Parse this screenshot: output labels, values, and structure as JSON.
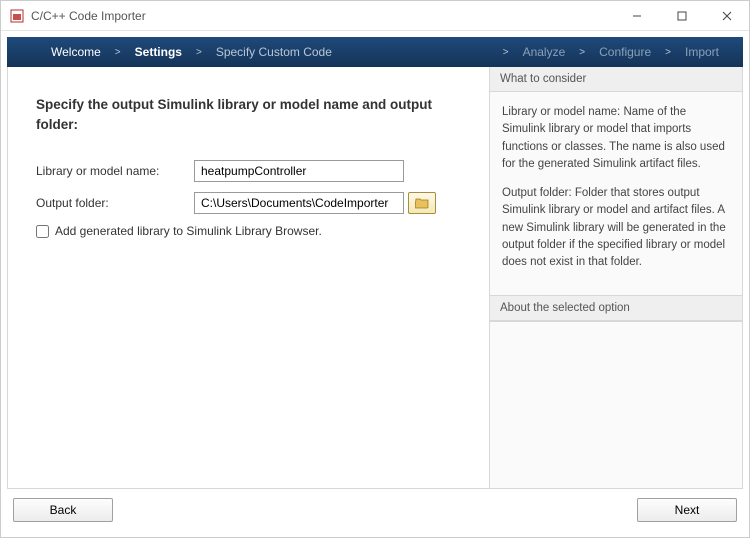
{
  "window": {
    "title": "C/C++ Code Importer"
  },
  "steps": {
    "welcome": "Welcome",
    "settings": "Settings",
    "specify": "Specify Custom Code",
    "analyze": "Analyze",
    "configure": "Configure",
    "import": "Import"
  },
  "page": {
    "heading": "Specify the output Simulink library or model name and output folder:",
    "libLabel": "Library or model name:",
    "libValue": "heatpumpController",
    "folderLabel": "Output folder:",
    "folderValue": "C:\\Users\\Documents\\CodeImporter",
    "addLibLabel": "Add generated library to Simulink Library Browser."
  },
  "help": {
    "considerHead": "What to consider",
    "considerP1": "Library or model name: Name of the Simulink library or model that imports functions or classes. The name is also used for the generated Simulink artifact files.",
    "considerP2": "Output folder: Folder that stores output Simulink library or model and artifact files. A new Simulink library will be generated in the output folder if the specified library or model does not exist in that folder.",
    "aboutHead": "About the selected option"
  },
  "footer": {
    "back": "Back",
    "next": "Next"
  }
}
